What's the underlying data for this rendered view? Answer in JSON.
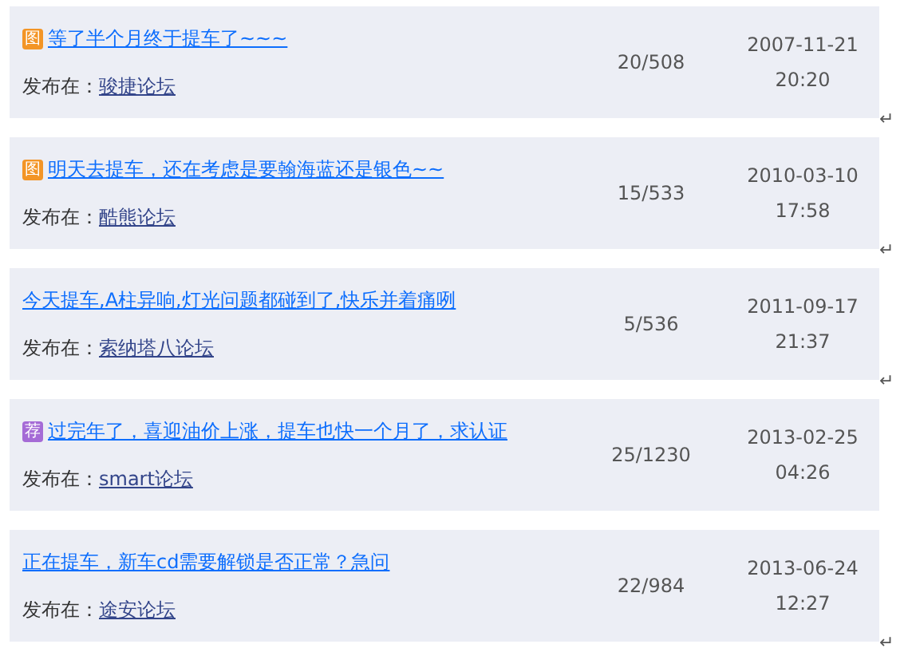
{
  "posts": [
    {
      "badge": {
        "kind": "image",
        "text": "图"
      },
      "title": "等了半个月终于提车了~~~",
      "forum_label": "发布在：",
      "forum": "骏捷论坛",
      "replies": "20/508",
      "date": "2007-11-21",
      "time": "20:20",
      "paragraph_mark": "↵"
    },
    {
      "badge": {
        "kind": "image",
        "text": "图"
      },
      "title": "明天去提车，还在考虑是要翰海蓝还是银色~~",
      "forum_label": "发布在：",
      "forum": "酷熊论坛",
      "replies": "15/533",
      "date": "2010-03-10",
      "time": "17:58",
      "paragraph_mark": "↵"
    },
    {
      "title": "今天提车,A柱异响,灯光问题都碰到了,快乐并着痛咧",
      "forum_label": "发布在：",
      "forum": "索纳塔八论坛",
      "replies": "5/536",
      "date": "2011-09-17",
      "time": "21:37",
      "paragraph_mark": "↵"
    },
    {
      "badge": {
        "kind": "recommend",
        "text": "荐"
      },
      "title": "过完年了，喜迎油价上涨，提车也快一个月了，求认证",
      "forum_label": "发布在：",
      "forum": "smart论坛",
      "replies": "25/1230",
      "date": "2013-02-25",
      "time": "04:26"
    },
    {
      "title": "正在提车，新车cd需要解锁是否正常？急问",
      "forum_label": "发布在：",
      "forum": "途安论坛",
      "replies": "22/984",
      "date": "2013-06-24",
      "time": "12:27",
      "paragraph_mark": "↵"
    }
  ]
}
